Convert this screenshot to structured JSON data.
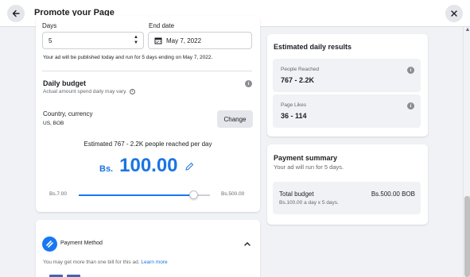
{
  "header": {
    "title": "Promote your Page",
    "back_icon": "arrow-left-icon",
    "close_icon": "close-icon"
  },
  "duration": {
    "days_label": "Days",
    "days_value": "5",
    "end_date_label": "End date",
    "end_date_value": "May 7, 2022",
    "publish_note": "Your ad will be published today and run for 5 days ending on May 7, 2022."
  },
  "budget": {
    "heading": "Daily budget",
    "subtext": "Actual amount spend daily may vary.",
    "country_label": "Country, currency",
    "country_value": "US, BOB",
    "change_button": "Change",
    "estimate_text": "Estimated 767 - 2.2K people reached per day",
    "currency_symbol": "Bs.",
    "amount": "100.00",
    "slider_min": "Bs.7.00",
    "slider_max": "Bs.500.00",
    "slider_fraction": 0.875
  },
  "payment_method": {
    "title": "Payment Method",
    "note": "You may get more than one bill for this ad.",
    "learn_more": "Learn more"
  },
  "estimated_results": {
    "heading": "Estimated daily results",
    "reach_label": "People Reached",
    "reach_value": "767 - 2.2K",
    "likes_label": "Page Likes",
    "likes_value": "36 - 114"
  },
  "payment_summary": {
    "heading": "Payment summary",
    "subtext": "Your ad will run for 5 days.",
    "total_label": "Total budget",
    "total_value": "Bs.500.00 BOB",
    "total_detail": "Bs.100.00 a day x 5 days."
  },
  "colors": {
    "accent": "#1877f2",
    "amount_blue": "#1b74e4"
  }
}
